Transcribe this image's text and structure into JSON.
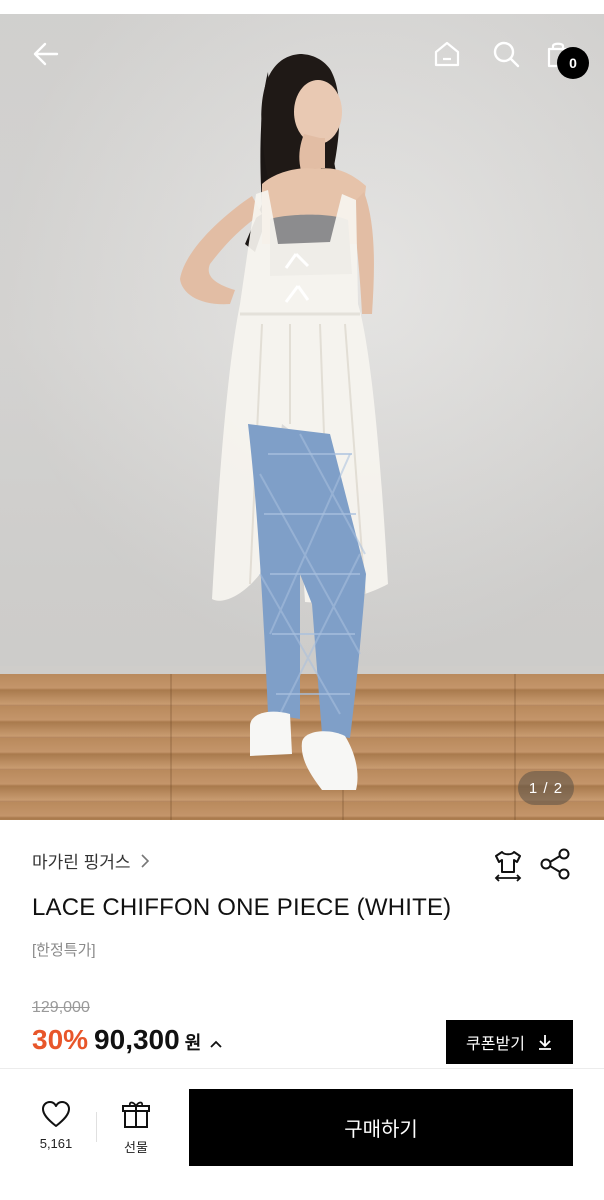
{
  "header": {
    "back_icon": "arrow-left-icon",
    "home_icon": "home-icon",
    "search_icon": "search-icon",
    "cart_icon": "shopping-bag-icon",
    "cart_count": "0"
  },
  "gallery": {
    "page_indicator": "1 / 2"
  },
  "product": {
    "brand": "마가린 핑거스",
    "title": "LACE CHIFFON ONE PIECE (WHITE)",
    "tag": "[한정특가]",
    "original_price": "129,000",
    "discount": "30%",
    "price": "90,300",
    "currency": "원",
    "coupon_label": "쿠폰받기"
  },
  "bottom_bar": {
    "like_count": "5,161",
    "gift_label": "선물",
    "buy_label": "구매하기"
  },
  "colors": {
    "accent_discount": "#e8562a",
    "primary_button": "#000000",
    "muted_text": "#8a8a8a"
  }
}
